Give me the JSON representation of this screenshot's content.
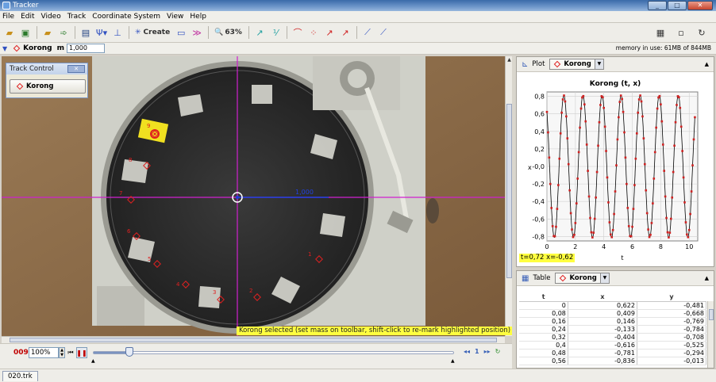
{
  "window": {
    "title": "Tracker"
  },
  "menu": [
    "File",
    "Edit",
    "Video",
    "Track",
    "Coordinate System",
    "View",
    "Help"
  ],
  "toolbar": {
    "create_label": "Create",
    "zoom_label": "63%"
  },
  "track": {
    "name": "Korong",
    "mass_label": "m",
    "mass_value": "1,000",
    "memory": "memory in use: 61MB of 844MB"
  },
  "track_control": {
    "title": "Track Control",
    "track_button": "Korong"
  },
  "video": {
    "status_message": "Korong selected (set mass on toolbar, shift-click to re-mark highlighted position)",
    "axis_label": "1,000",
    "point_labels": [
      "9",
      "8",
      "7",
      "6",
      "5",
      "4",
      "3",
      "2",
      "1"
    ]
  },
  "player": {
    "frame": "009",
    "rate": "100%",
    "step_size": "1",
    "progress": 0.1
  },
  "plot": {
    "title_label": "Plot",
    "track": "Korong",
    "readout": "t=0,72  x=-0,62"
  },
  "chart_data": {
    "type": "line",
    "title": "Korong (t, x)",
    "xlabel": "t",
    "ylabel": "x",
    "xlim": [
      0,
      10.6
    ],
    "ylim": [
      -0.85,
      0.85
    ],
    "xticks": [
      "0",
      "2",
      "4",
      "6",
      "8",
      "10"
    ],
    "yticks": [
      "-0,8",
      "-0,6",
      "-0,4",
      "-0,2",
      "-0,0",
      "0,2",
      "0,4",
      "0,6",
      "0,8"
    ],
    "series": [
      {
        "amplitude": 0.81,
        "period": 1.34,
        "phase_x0": 0.622,
        "t_step": 0.08,
        "t_max": 10.4
      }
    ]
  },
  "table": {
    "title_label": "Table",
    "track": "Korong",
    "columns": [
      "t",
      "x",
      "y"
    ],
    "rows": [
      [
        "0",
        "0,622",
        "-0,481"
      ],
      [
        "0,08",
        "0,409",
        "-0,668"
      ],
      [
        "0,16",
        "0,146",
        "-0,769"
      ],
      [
        "0,24",
        "-0,133",
        "-0,784"
      ],
      [
        "0,32",
        "-0,404",
        "-0,708"
      ],
      [
        "0,4",
        "-0,616",
        "-0,525"
      ],
      [
        "0,48",
        "-0,781",
        "-0,294"
      ],
      [
        "0,56",
        "-0,836",
        "-0,013"
      ]
    ]
  },
  "file_tab": "020.trk",
  "colors": {
    "accent": "#e02020",
    "axis": "#d020d0",
    "highlight": "#ffff40"
  }
}
